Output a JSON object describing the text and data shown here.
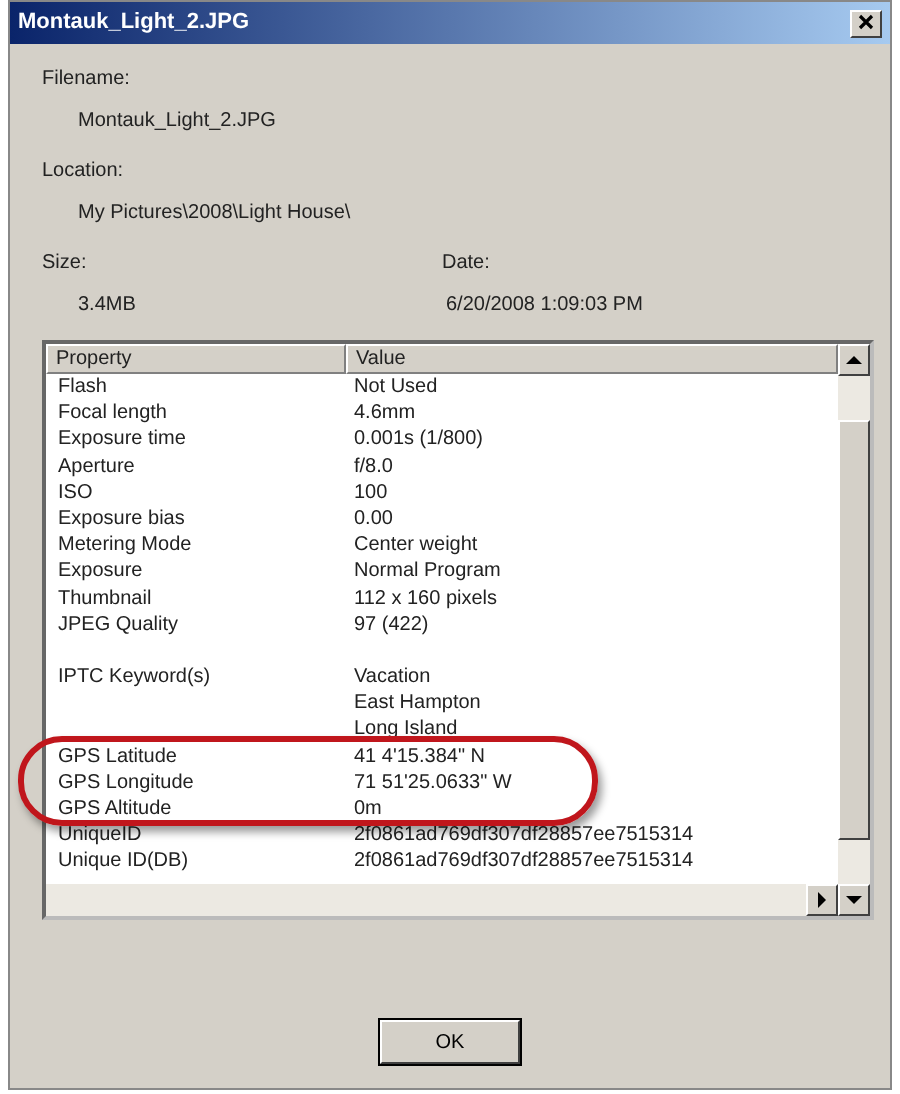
{
  "window": {
    "title": "Montauk_Light_2.JPG"
  },
  "filename": {
    "label": "Filename:",
    "value": "Montauk_Light_2.JPG"
  },
  "location": {
    "label": "Location:",
    "value": "My Pictures\\2008\\Light House\\"
  },
  "size": {
    "label": "Size:",
    "value": "3.4MB"
  },
  "date": {
    "label": "Date:",
    "value": "6/20/2008 1:09:03 PM"
  },
  "table": {
    "columns": [
      "Property",
      "Value"
    ],
    "rows": [
      {
        "property": "Flash",
        "value": "Not Used"
      },
      {
        "property": "Focal length",
        "value": "4.6mm"
      },
      {
        "property": "Exposure time",
        "value": "0.001s (1/800)"
      },
      {
        "property": "Aperture",
        "value": "f/8.0"
      },
      {
        "property": "ISO",
        "value": "100"
      },
      {
        "property": "Exposure bias",
        "value": "0.00"
      },
      {
        "property": "Metering Mode",
        "value": "Center weight"
      },
      {
        "property": "Exposure",
        "value": "Normal Program"
      },
      {
        "property": "Thumbnail",
        "value": "112 x 160 pixels"
      },
      {
        "property": "JPEG Quality",
        "value": "97 (422)"
      },
      {
        "property": "",
        "value": ""
      },
      {
        "property": "IPTC Keyword(s)",
        "value": "Vacation"
      },
      {
        "property": "",
        "value": "East Hampton"
      },
      {
        "property": "",
        "value": "Long Island"
      },
      {
        "property": "GPS Latitude",
        "value": "41 4'15.384\" N"
      },
      {
        "property": "GPS Longitude",
        "value": "71 51'25.0633\" W"
      },
      {
        "property": "GPS Altitude",
        "value": "0m"
      },
      {
        "property": "UniqueID",
        "value": "2f0861ad769df307df28857ee7515314"
      },
      {
        "property": "Unique ID(DB)",
        "value": "2f0861ad769df307df28857ee7515314"
      }
    ]
  },
  "buttons": [
    "OK"
  ]
}
